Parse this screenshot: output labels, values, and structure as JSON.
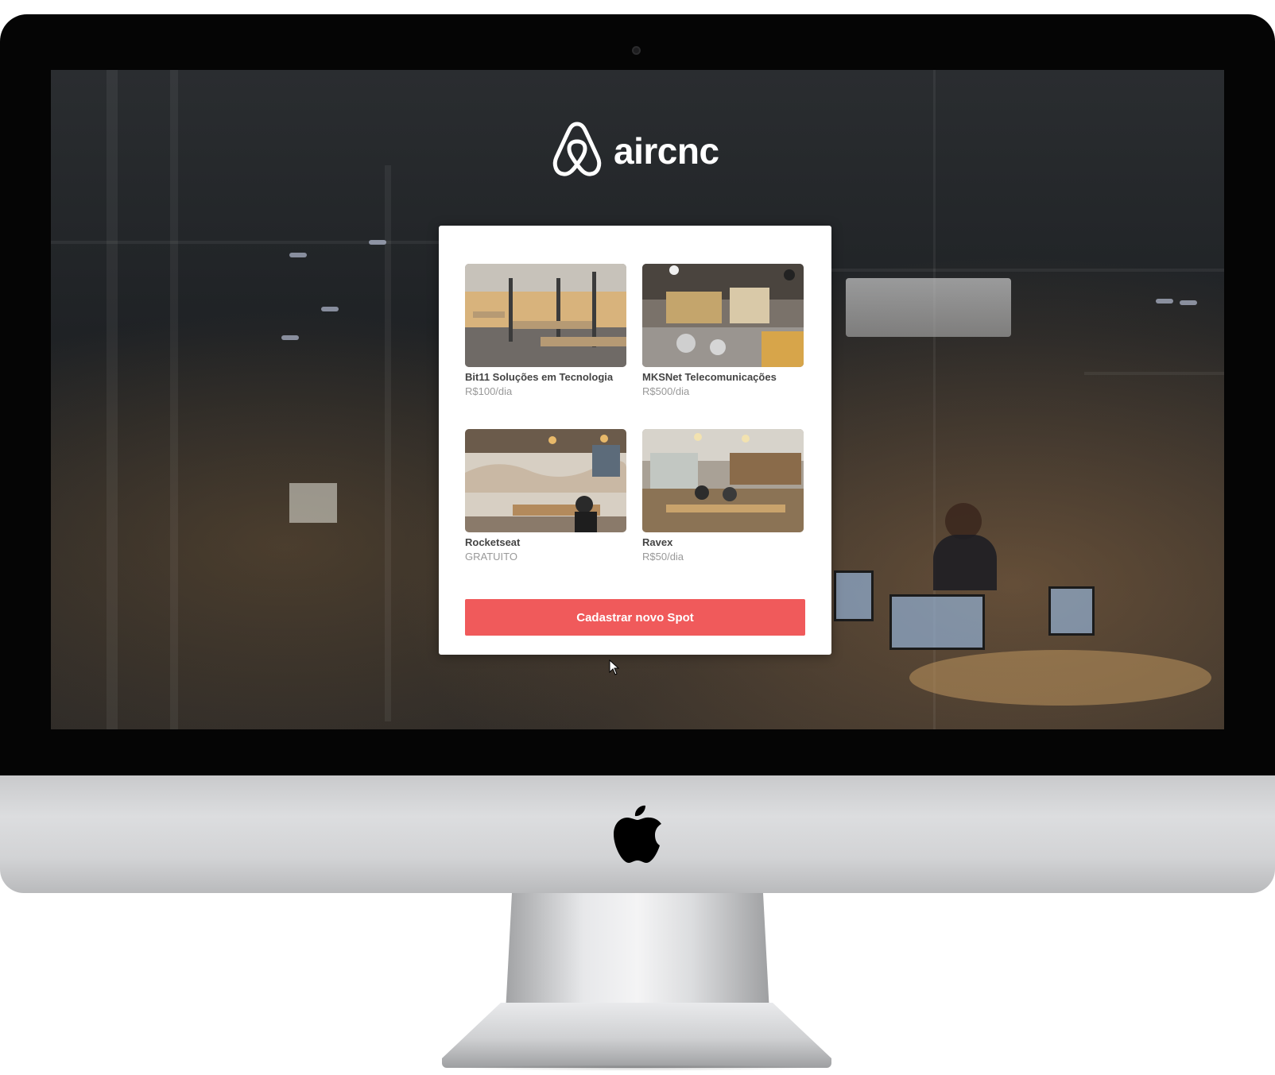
{
  "app": {
    "logo_text": "aircnc"
  },
  "spots": [
    {
      "company": "Bit11 Soluções em Tecnologia",
      "price": "R$100/dia"
    },
    {
      "company": "MKSNet Telecomunicações",
      "price": "R$500/dia"
    },
    {
      "company": "Rocketseat",
      "price": "GRATUITO"
    },
    {
      "company": "Ravex",
      "price": "R$50/dia"
    }
  ],
  "actions": {
    "new_spot_label": "Cadastrar novo Spot"
  },
  "colors": {
    "accent": "#f05a5b",
    "title_text": "#444444",
    "price_text": "#999999"
  },
  "icons": {
    "logo": "airbnb-belo-icon",
    "device": "apple-icon",
    "pointer": "mouse-cursor-icon"
  }
}
